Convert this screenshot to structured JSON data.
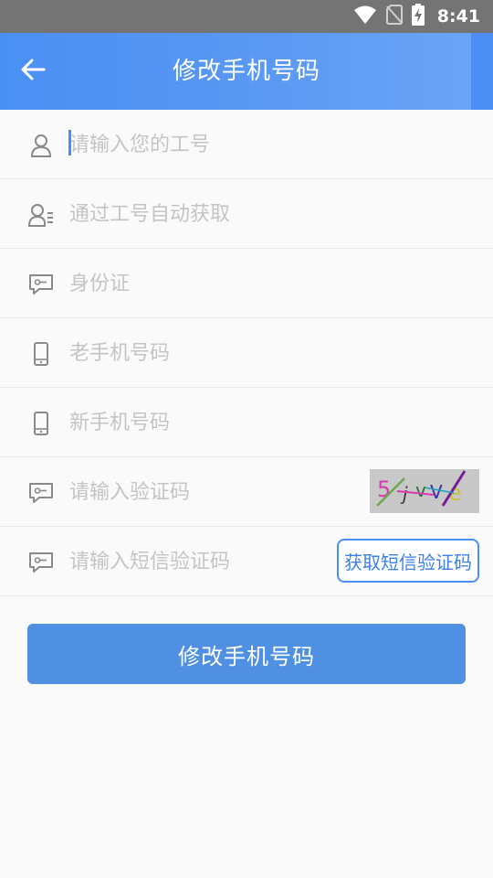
{
  "status_bar": {
    "time": "8:41",
    "icons": [
      "wifi-icon",
      "no-sim-icon",
      "battery-charging-icon"
    ]
  },
  "header": {
    "title": "修改手机号码",
    "back_icon": "arrow-left-icon"
  },
  "form": {
    "employee_id": {
      "placeholder": "请输入您的工号",
      "icon": "user-icon"
    },
    "name": {
      "placeholder": "通过工号自动获取",
      "icon": "user-list-icon"
    },
    "id_card": {
      "placeholder": "身份证",
      "icon": "key-message-icon"
    },
    "old_phone": {
      "placeholder": "老手机号码",
      "icon": "phone-icon"
    },
    "new_phone": {
      "placeholder": "新手机号码",
      "icon": "phone-icon"
    },
    "captcha": {
      "placeholder": "请输入验证码",
      "icon": "key-message-icon",
      "image_text": "5jvVe"
    },
    "sms_code": {
      "placeholder": "请输入短信验证码",
      "icon": "key-message-icon",
      "button_label": "获取短信验证码"
    }
  },
  "submit_label": "修改手机号码",
  "colors": {
    "primary": "#4a8ff3",
    "button": "#4f90e2",
    "placeholder": "#c4c4c4",
    "status_bar": "#747474"
  }
}
